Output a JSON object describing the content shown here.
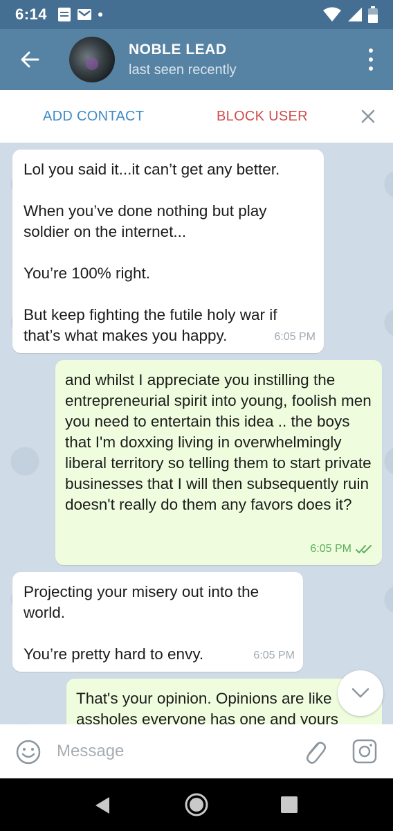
{
  "status_bar": {
    "time": "6:14"
  },
  "header": {
    "contact_name": "NOBLE LEAD",
    "last_seen": "last seen recently"
  },
  "action_bar": {
    "add_contact": "ADD CONTACT",
    "block_user": "BLOCK USER"
  },
  "messages": [
    {
      "direction": "incoming",
      "text": "Lol you said it...it can’t get any better.\n\nWhen you’ve done nothing but play soldier on the internet...\n\nYou’re 100% right.\n\nBut keep fighting the futile holy war if that’s what makes you happy.",
      "time": "6:05 PM"
    },
    {
      "direction": "outgoing",
      "text": "and whilst I appreciate you instilling the entrepreneurial spirit into young, foolish men you need to entertain this idea .. the boys that I'm doxxing living in overwhelmingly liberal territory so telling them to start private businesses that I will then subsequently ruin doesn't really do them any favors does it?",
      "time": "6:05 PM",
      "status": "read"
    },
    {
      "direction": "incoming",
      "text": "Projecting your misery out into the world.\n\nYou’re pretty hard to envy.",
      "time": "6:05 PM"
    },
    {
      "direction": "outgoing",
      "text": "That's your opinion. Opinions are like assholes everyone has one and yours"
    }
  ],
  "input": {
    "placeholder": "Message"
  },
  "colors": {
    "header": "#5682a3",
    "status_bar": "#456f92",
    "outgoing_bubble": "#effdde",
    "incoming_bubble": "#ffffff",
    "link_blue": "#3f8bc6",
    "danger_red": "#d04b4b",
    "chat_background": "#cfdbe6"
  },
  "icons": [
    "back-arrow-icon",
    "more-vert-icon",
    "close-icon",
    "double-check-icon",
    "chevron-down-icon",
    "emoji-icon",
    "paperclip-icon",
    "camera-icon"
  ]
}
